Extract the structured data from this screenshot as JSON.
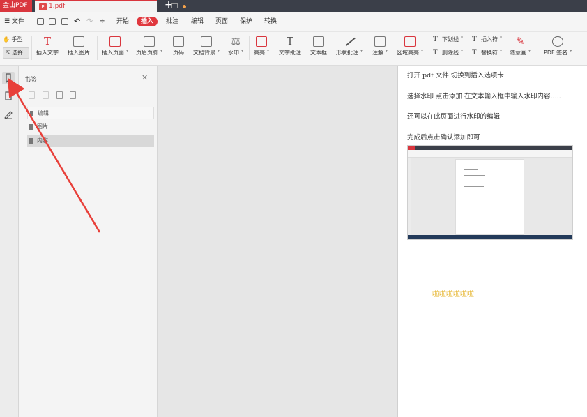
{
  "titlebar": {
    "app_name": "金山PDF",
    "file_name": "1.pdf",
    "new_tab": "+"
  },
  "menubar": {
    "file_menu": "☰ 文件",
    "tabs": [
      "开始",
      "插入",
      "批注",
      "编辑",
      "页面",
      "保护",
      "转换"
    ],
    "active_tab": "插入"
  },
  "ribbon": {
    "hand_tool": "手型",
    "select_tool": "选择",
    "buttons": [
      "插入文字",
      "插入图片",
      "插入页面",
      "页眉页脚",
      "页码",
      "文档背景",
      "水印",
      "高亮",
      "文字批注",
      "文本框",
      "形状批注",
      "注解",
      "区域高亮",
      "PDF 签名"
    ],
    "small_buttons": [
      "下划线",
      "删除线",
      "插入符",
      "替换符",
      "随意画"
    ],
    "dropdown_marker": "˅"
  },
  "bookmark_panel": {
    "title": "书签",
    "close": "✕",
    "items": [
      "编辑",
      "图片",
      "内容"
    ],
    "selected_index": 2
  },
  "document": {
    "lines": [
      "打开 pdf 文件   切换到插入选项卡",
      "选择水印     点击添加    在文本输入框中输入水印内容.....",
      "还可以在此页面进行水印的编辑",
      "完成后点击确认添加即可"
    ],
    "watermark_text": "啦啦啦啦啦啦",
    "watermark_color": "#e6b52e"
  },
  "colors": {
    "accent": "#d9363e",
    "titlebar": "#3b3f49",
    "arrow": "#e8403a"
  },
  "icons": {
    "bookmark": "bookmark-icon",
    "thumbnail": "thumbnail-icon",
    "signature": "signature-icon",
    "annotation_arrow": "red-arrow"
  }
}
